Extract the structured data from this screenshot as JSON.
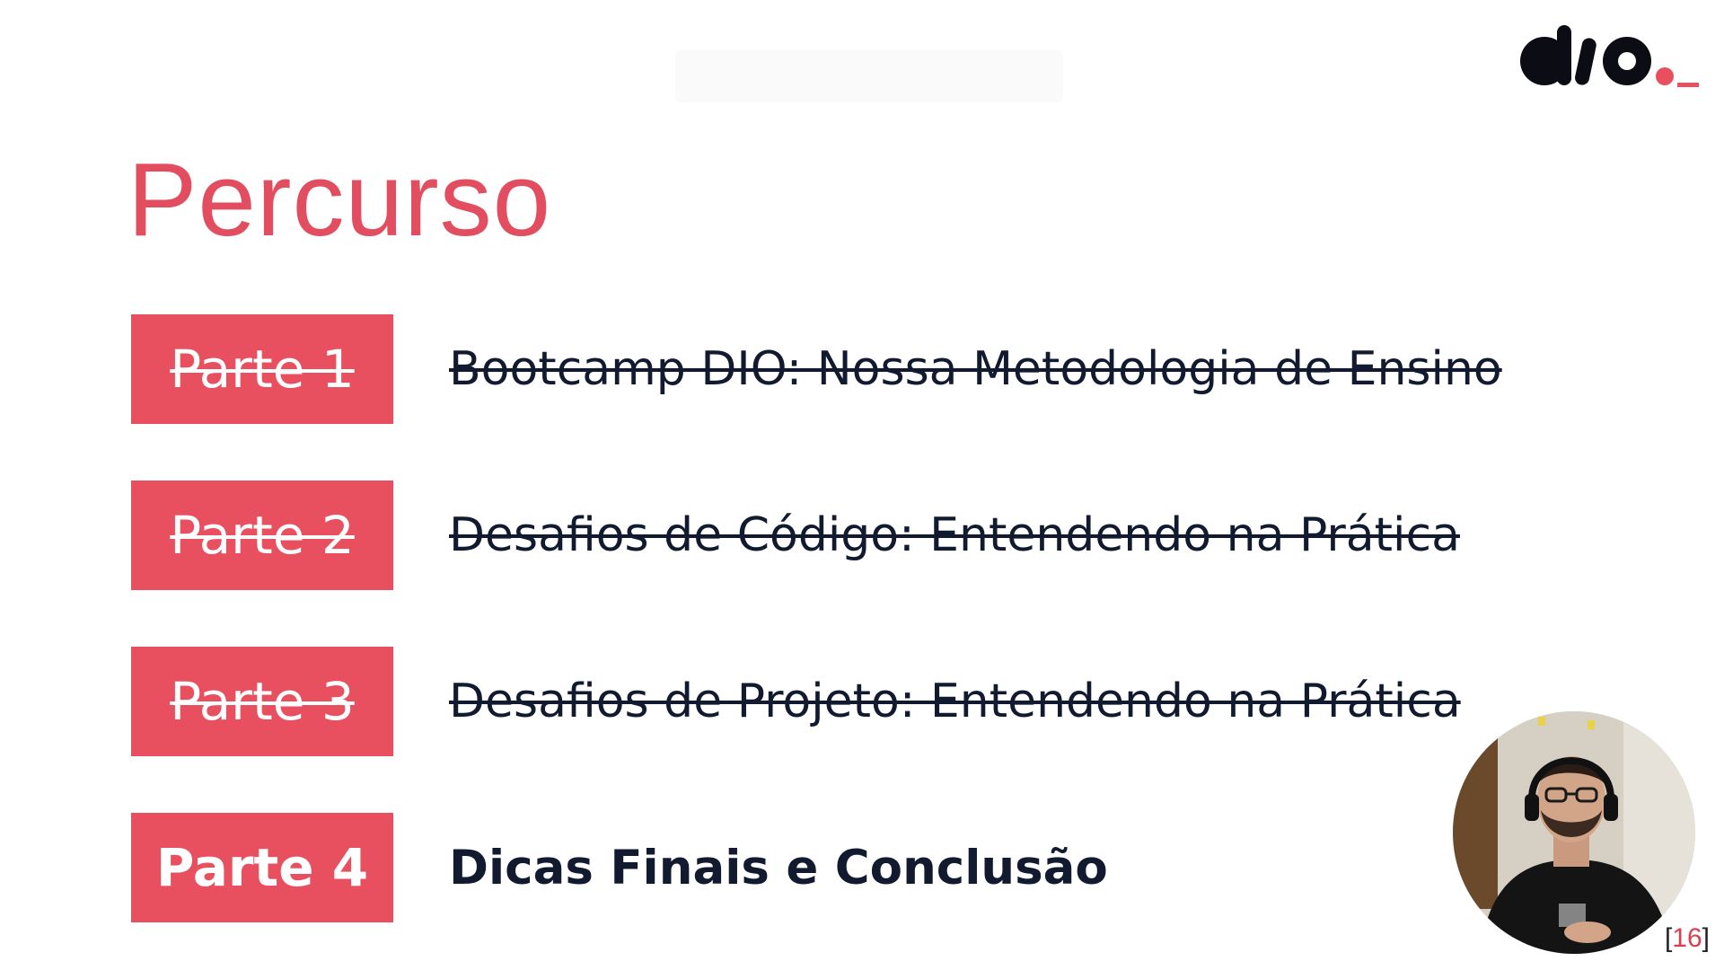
{
  "brand": {
    "logo_text": "dio.",
    "accent_color": "#e8505f",
    "title_color": "#e24e60"
  },
  "slide": {
    "title": "Percurso",
    "page_open": "[",
    "page_number": "16",
    "page_close": "]"
  },
  "agenda": [
    {
      "part": "Parte 1",
      "topic": "Bootcamp DIO: Nossa Metodologia de Ensino",
      "completed": true
    },
    {
      "part": "Parte 2",
      "topic": "Desafios de Código: Entendendo na Prática",
      "completed": true
    },
    {
      "part": "Parte 3",
      "topic": "Desafios de Projeto: Entendendo na Prática",
      "completed": true
    },
    {
      "part": "Parte 4",
      "topic": "Dicas Finais e Conclusão",
      "completed": false
    }
  ],
  "presenter": {
    "icon": "webcam-presenter-icon"
  }
}
